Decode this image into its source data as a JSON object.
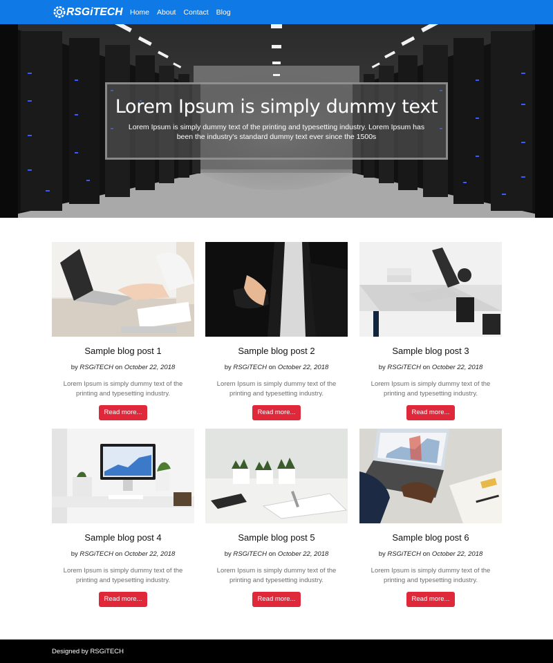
{
  "navbar": {
    "brand": "RSGiTECH",
    "links": [
      "Home",
      "About",
      "Contact",
      "Blog"
    ],
    "color": "#0f7ae5"
  },
  "hero": {
    "title": "Lorem Ipsum is simply dummy text",
    "text": "Lorem Ipsum is simply dummy text of the printing and typesetting industry. Lorem Ipsum has been the industry's standard dummy text ever since the 1500s"
  },
  "posts": [
    {
      "title": "Sample blog post 1",
      "by": "by",
      "author": "RSGiTECH",
      "on": "on",
      "date": "October 22, 2018",
      "desc": "Lorem Ipsum is simply dummy text of the printing and typesetting industry.",
      "button": "Read more..."
    },
    {
      "title": "Sample blog post 2",
      "by": "by",
      "author": "RSGiTECH",
      "on": "on",
      "date": "October 22, 2018",
      "desc": "Lorem Ipsum is simply dummy text of the printing and typesetting industry.",
      "button": "Read more..."
    },
    {
      "title": "Sample blog post 3",
      "by": "by",
      "author": "RSGiTECH",
      "on": "on",
      "date": "October 22, 2018",
      "desc": "Lorem Ipsum is simply dummy text of the printing and typesetting industry.",
      "button": "Read more..."
    },
    {
      "title": "Sample blog post 4",
      "by": "by",
      "author": "RSGiTECH",
      "on": "on",
      "date": "October 22, 2018",
      "desc": "Lorem Ipsum is simply dummy text of the printing and typesetting industry.",
      "button": "Read more..."
    },
    {
      "title": "Sample blog post 5",
      "by": "by",
      "author": "RSGiTECH",
      "on": "on",
      "date": "October 22, 2018",
      "desc": "Lorem Ipsum is simply dummy text of the printing and typesetting industry.",
      "button": "Read more..."
    },
    {
      "title": "Sample blog post 6",
      "by": "by",
      "author": "RSGiTECH",
      "on": "on",
      "date": "October 22, 2018",
      "desc": "Lorem Ipsum is simply dummy text of the printing and typesetting industry.",
      "button": "Read more..."
    }
  ],
  "button_color": "#e0283b",
  "footer": {
    "text": "Designed by RSGiTECH"
  }
}
